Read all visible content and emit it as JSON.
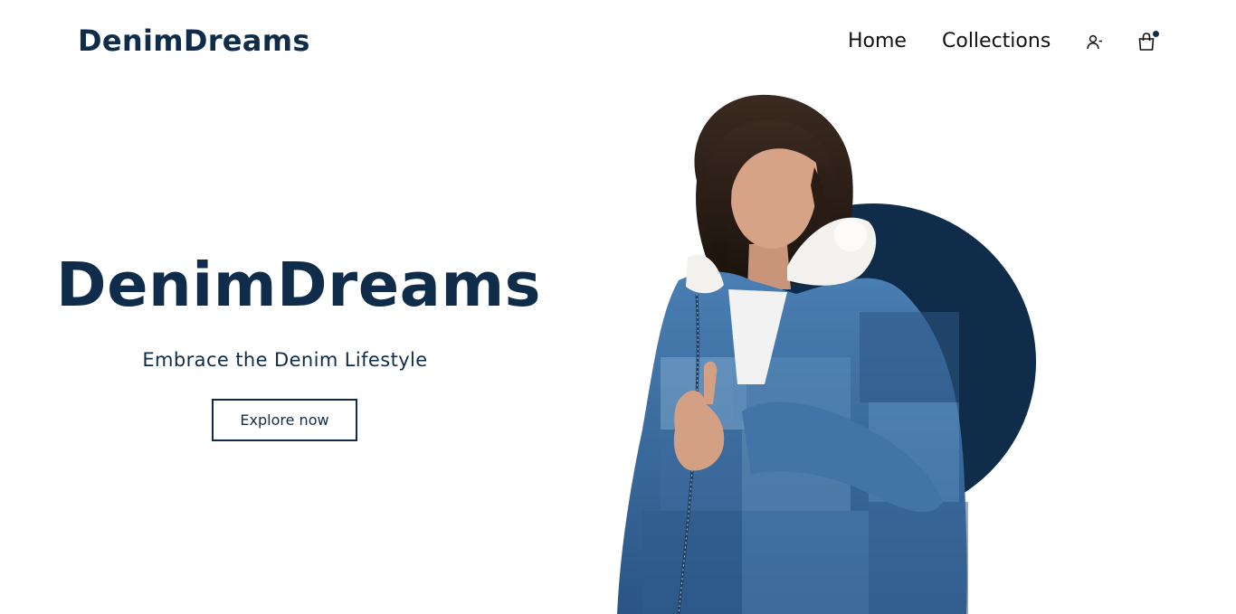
{
  "header": {
    "brand": "DenimDreams",
    "nav": [
      {
        "label": "Home"
      },
      {
        "label": "Collections"
      }
    ],
    "icons": {
      "account": "user-icon",
      "cart": "shopping-bag-icon",
      "cart_has_items": true
    }
  },
  "hero": {
    "title": "DenimDreams",
    "subtitle": "Embrace the Denim Lifestyle",
    "cta_label": "Explore now"
  },
  "colors": {
    "brand_navy": "#0f2d4a",
    "background": "#ffffff",
    "denim_blue": "#3f73a8"
  }
}
